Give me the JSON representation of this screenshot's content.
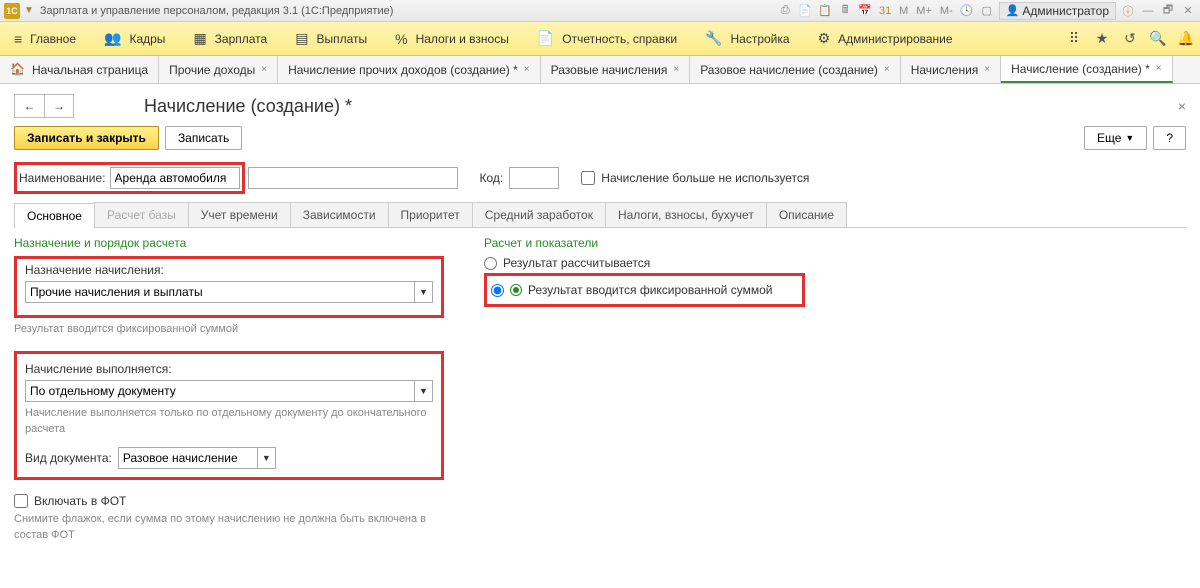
{
  "app": {
    "title": "Зарплата и управление персоналом, редакция 3.1  (1С:Предприятие)",
    "user": "Администратор"
  },
  "nav": {
    "items": [
      {
        "icon": "≡",
        "label": "Главное"
      },
      {
        "icon": "👥",
        "label": "Кадры"
      },
      {
        "icon": "▦",
        "label": "Зарплата"
      },
      {
        "icon": "▤",
        "label": "Выплаты"
      },
      {
        "icon": "%",
        "label": "Налоги и взносы"
      },
      {
        "icon": "📄",
        "label": "Отчетность, справки"
      },
      {
        "icon": "🔧",
        "label": "Настройка"
      },
      {
        "icon": "⚙",
        "label": "Администрирование"
      }
    ]
  },
  "tabs": [
    {
      "label": "Начальная страница",
      "icon": "home",
      "closable": false
    },
    {
      "label": "Прочие доходы",
      "closable": true
    },
    {
      "label": "Начисление прочих доходов (создание) *",
      "closable": true
    },
    {
      "label": "Разовые начисления",
      "closable": true
    },
    {
      "label": "Разовое начисление (создание)",
      "closable": true
    },
    {
      "label": "Начисления",
      "closable": true
    },
    {
      "label": "Начисление (создание) *",
      "closable": true,
      "active": true
    }
  ],
  "page": {
    "title": "Начисление (создание) *"
  },
  "toolbar": {
    "save_close": "Записать и закрыть",
    "save": "Записать",
    "more": "Еще",
    "help": "?"
  },
  "form": {
    "name_label": "Наименование:",
    "name_value": "Аренда автомобиля",
    "code_label": "Код:",
    "code_value": "",
    "disabled_label": "Начисление больше не используется"
  },
  "innertabs": [
    "Основное",
    "Расчет базы",
    "Учет времени",
    "Зависимости",
    "Приоритет",
    "Средний заработок",
    "Налоги, взносы, бухучет",
    "Описание"
  ],
  "left": {
    "section1": "Назначение и порядок расчета",
    "dest_label": "Назначение начисления:",
    "dest_value": "Прочие начисления и выплаты",
    "dest_hint": "Результат вводится фиксированной суммой",
    "exec_label": "Начисление выполняется:",
    "exec_value": "По отдельному документу",
    "exec_hint": "Начисление выполняется только по отдельному документу до окончательного расчета",
    "doc_label": "Вид документа:",
    "doc_value": "Разовое начисление",
    "fot_label": "Включать в ФОТ",
    "fot_hint": "Снимите флажок, если сумма по этому начислению не должна быть включена в состав ФОТ"
  },
  "right": {
    "section": "Расчет и показатели",
    "opt1": "Результат рассчитывается",
    "opt2": "Результат вводится фиксированной суммой"
  }
}
